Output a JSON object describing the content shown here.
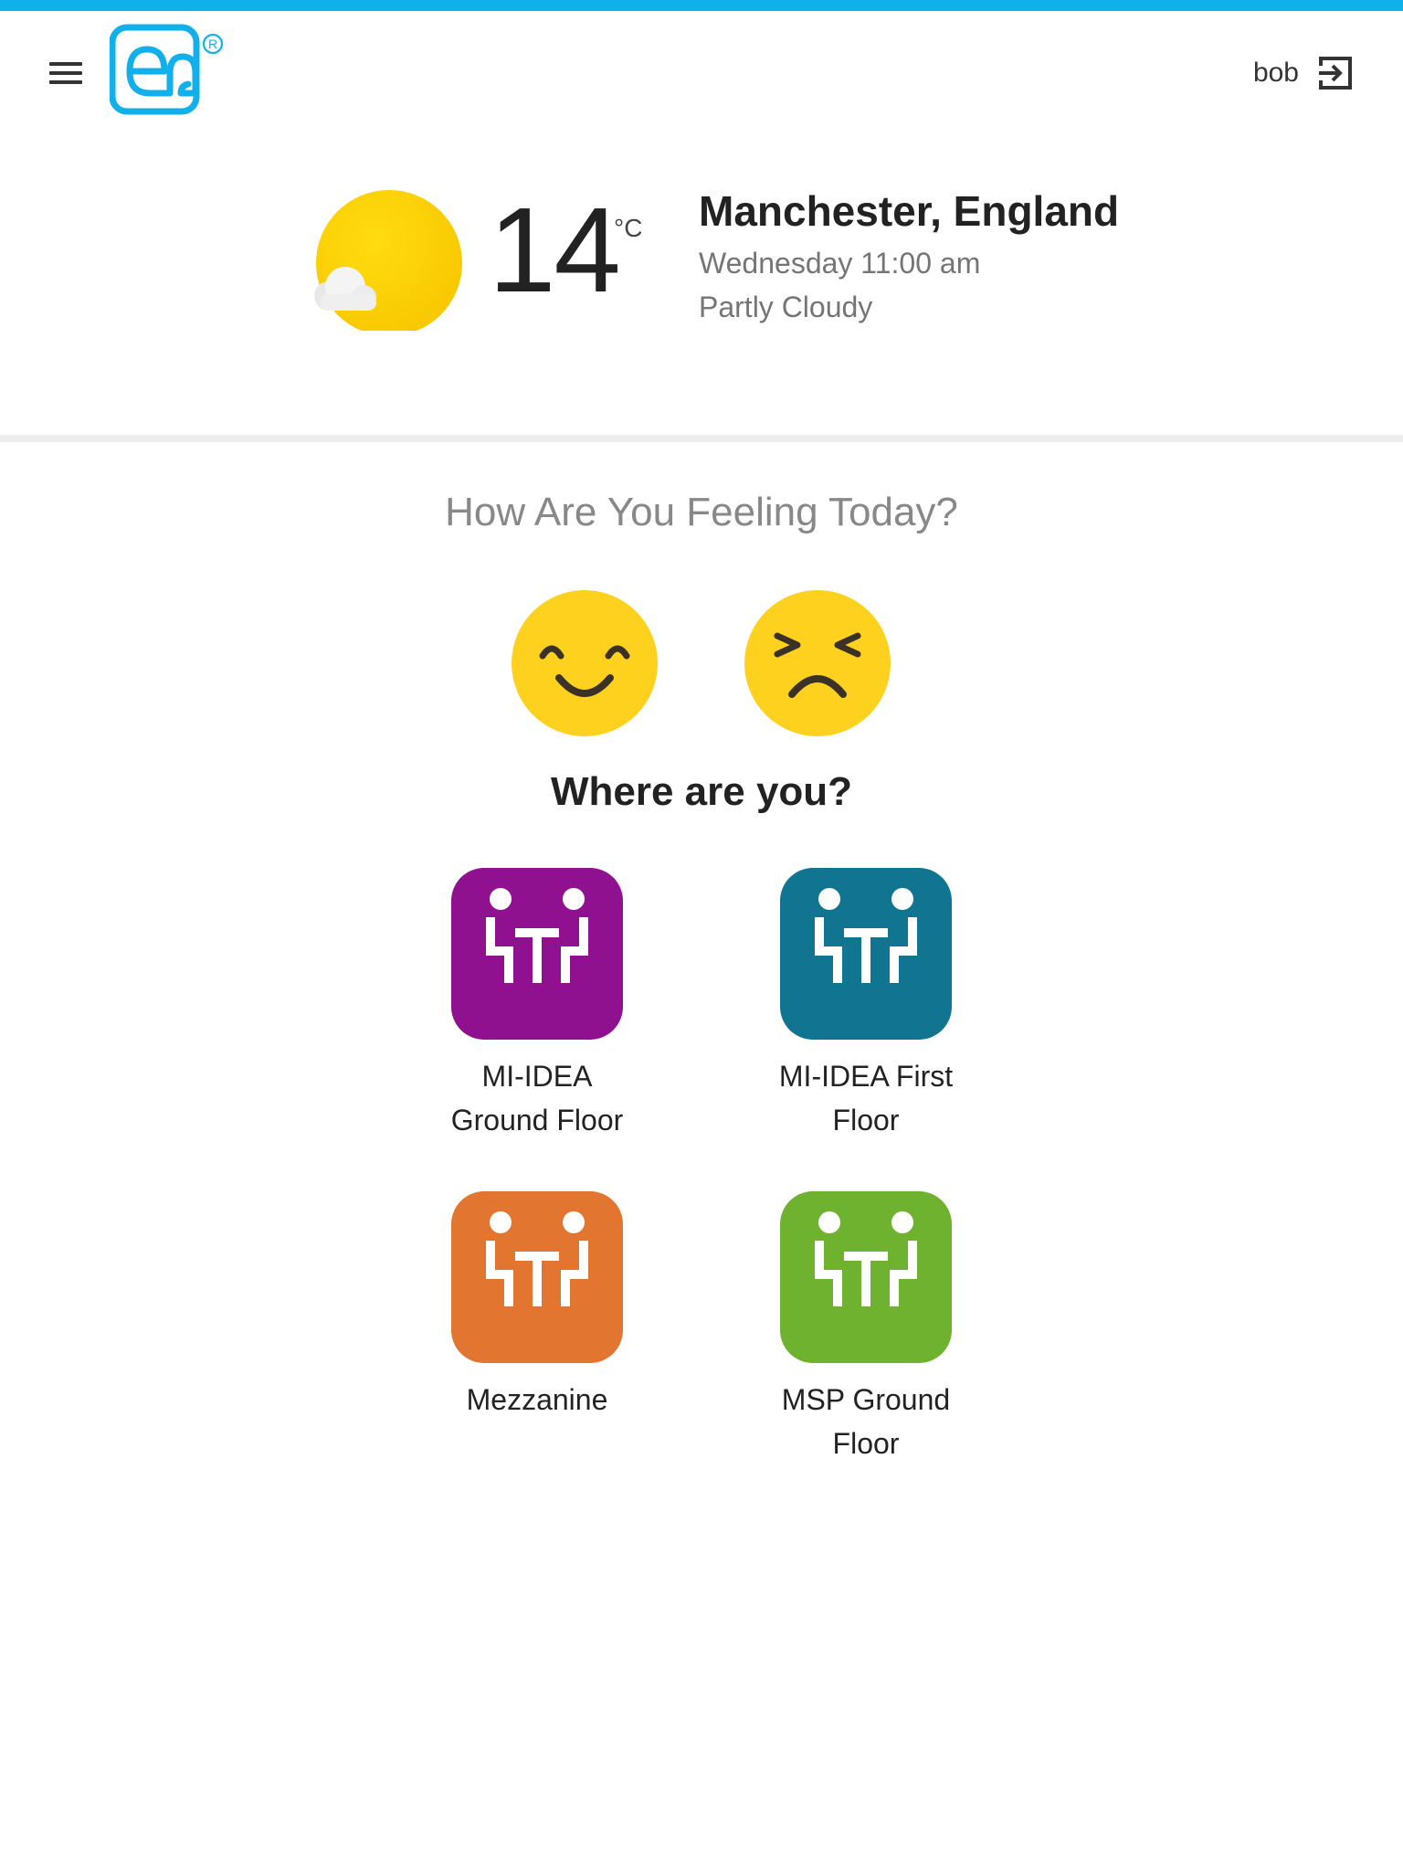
{
  "header": {
    "username": "bob",
    "accent_color": "#11b0ea"
  },
  "weather": {
    "temperature": "14",
    "unit": "°C",
    "location": "Manchester, England",
    "datetime": "Wednesday 11:00 am",
    "condition": "Partly Cloudy"
  },
  "mood": {
    "title": "How Are You Feeling Today?",
    "options": [
      {
        "icon": "happy-face-icon"
      },
      {
        "icon": "unhappy-face-icon"
      }
    ]
  },
  "locations": {
    "title": "Where are you?",
    "items": [
      {
        "line1": "MI-IDEA",
        "line2": "Ground Floor",
        "color": "#8f1190"
      },
      {
        "line1": "MI-IDEA First",
        "line2": "Floor",
        "color": "#117592"
      },
      {
        "line1": "Mezzanine",
        "line2": "",
        "color": "#e2752f"
      },
      {
        "line1": "MSP Ground",
        "line2": "Floor",
        "color": "#6eb22f"
      }
    ]
  }
}
